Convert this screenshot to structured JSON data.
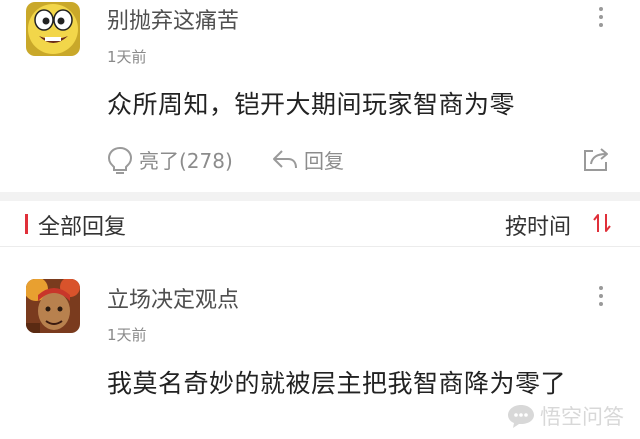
{
  "comments": [
    {
      "username": "别抛弃这痛苦",
      "time": "1天前",
      "text": "众所周知，铠开大期间玩家智商为零",
      "like_label": "亮了(278)",
      "reply_label": "回复"
    },
    {
      "username": "立场决定观点",
      "time": "1天前",
      "text": "我莫名奇妙的就被层主把我智商降为零了"
    }
  ],
  "section": {
    "title": "全部回复",
    "sort_label": "按时间"
  },
  "watermark": {
    "text": "悟空问答"
  },
  "colors": {
    "accent": "#e0303a",
    "muted": "#8c8c8c",
    "divider": "#f2f2f2"
  },
  "icons": {
    "more": "vertical-ellipsis",
    "like": "lightbulb",
    "reply": "reply-arrow",
    "share": "share-arrow",
    "sort": "sort-up-down-arrows"
  }
}
